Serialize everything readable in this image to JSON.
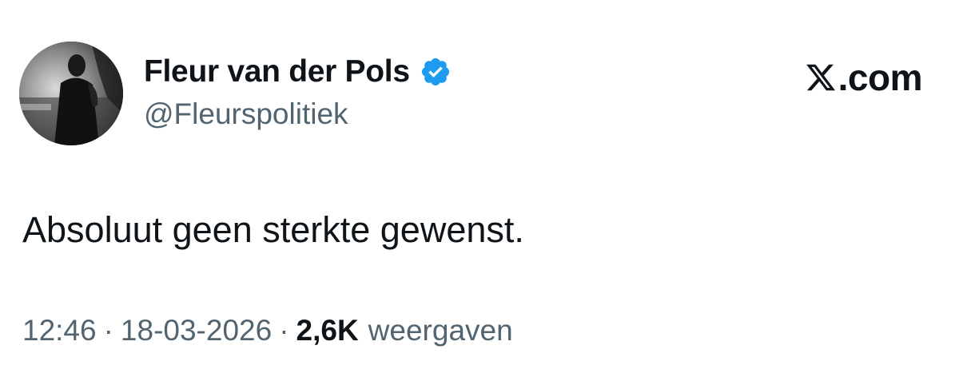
{
  "author": {
    "display_name": "Fleur van der Pols",
    "handle": "@Fleurspolitiek",
    "verified": true,
    "verified_color": "#1d9bf0",
    "avatar_icon": "profile-photo"
  },
  "brand": {
    "text": ".com",
    "icon": "x-logo-icon"
  },
  "tweet": {
    "text": "Absoluut geen sterkte gewenst."
  },
  "meta": {
    "time": "12:46",
    "separator": "·",
    "date": "18-03-2026",
    "views_count": "2,6K",
    "views_label": "weergaven"
  },
  "colors": {
    "text_primary": "#0f1419",
    "text_secondary": "#536471",
    "background": "#ffffff"
  }
}
